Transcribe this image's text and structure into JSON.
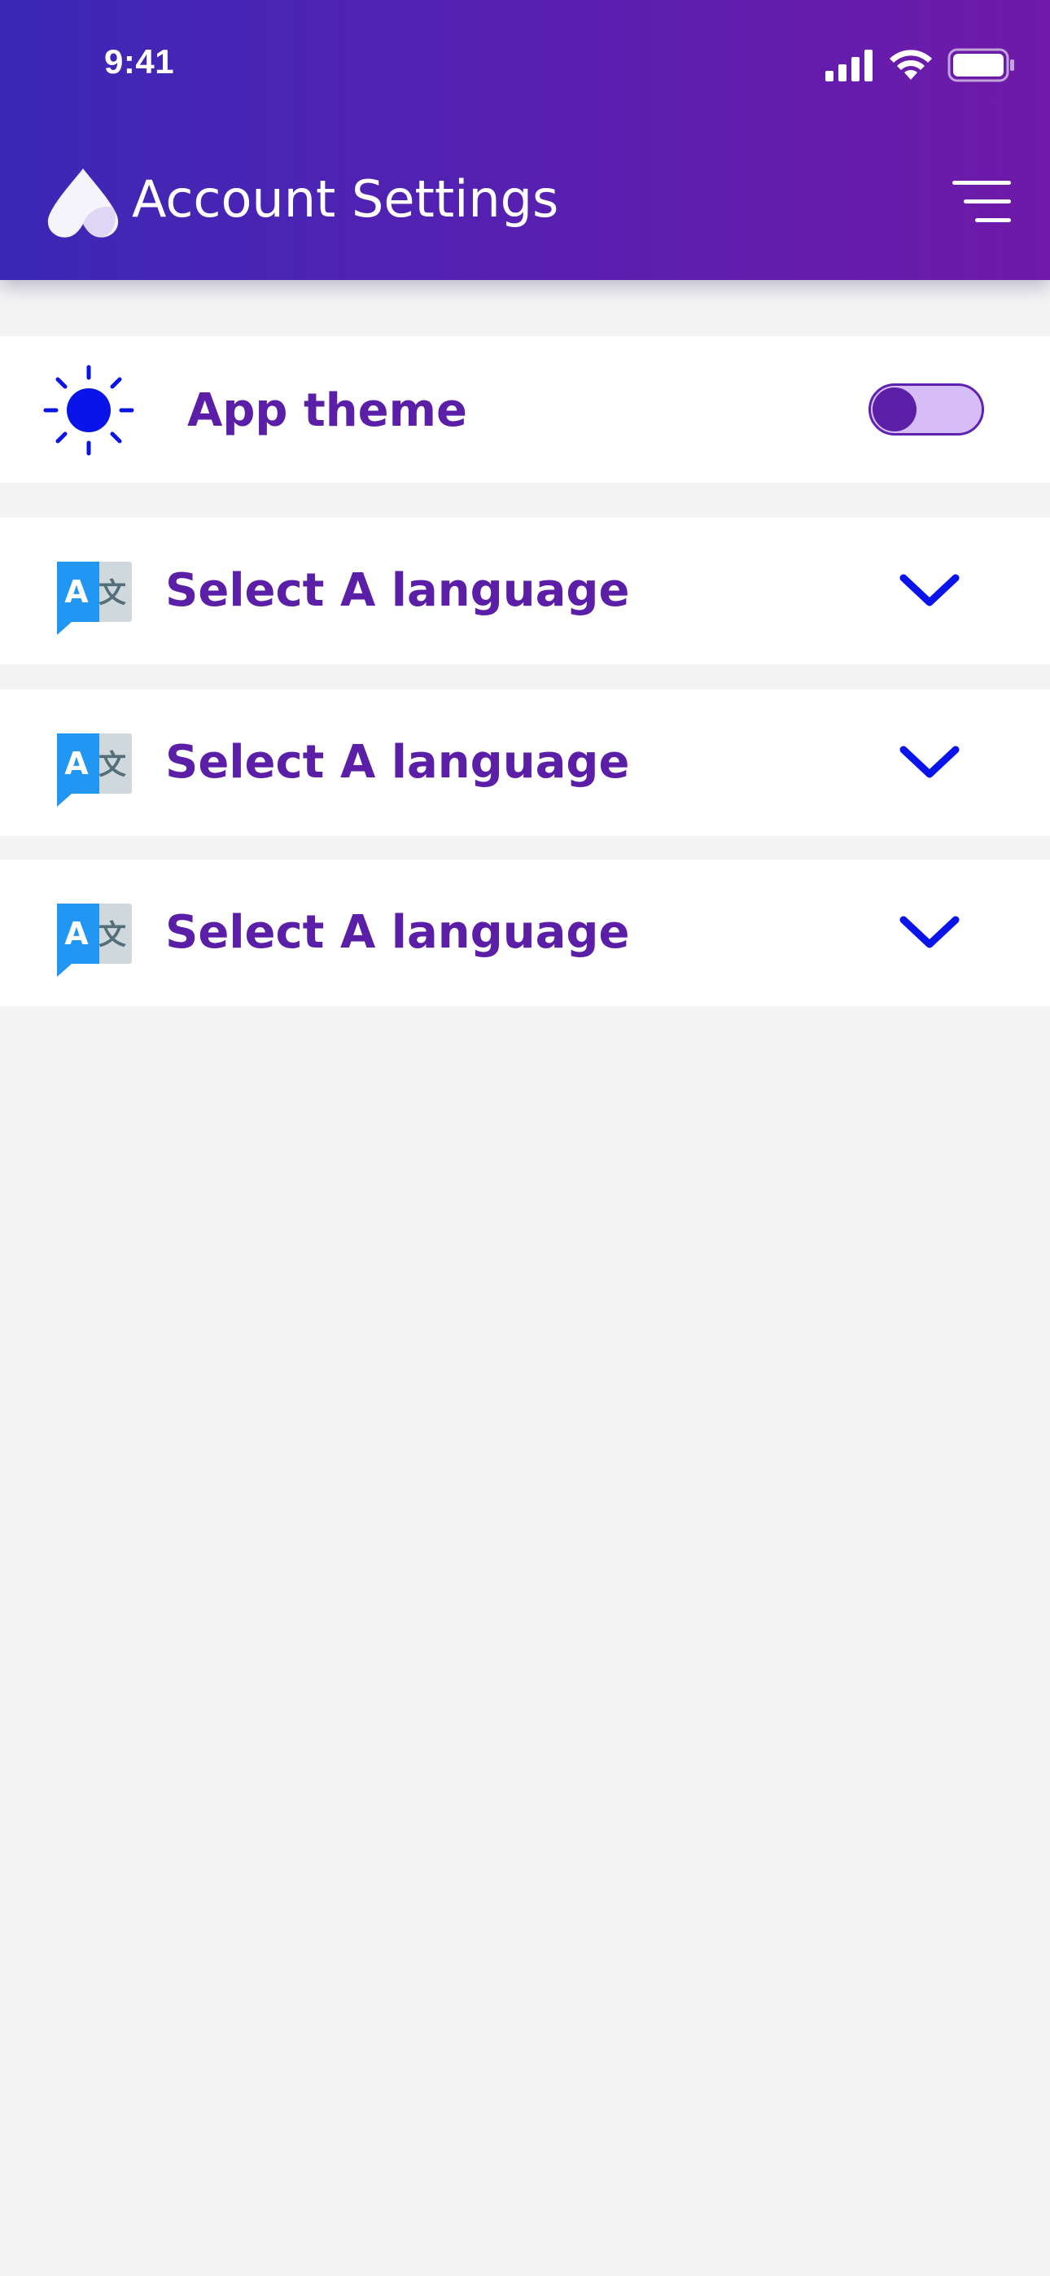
{
  "status_bar": {
    "time": "9:41"
  },
  "header": {
    "title": "Account Settings",
    "logo_icon": "app-logo-icon",
    "menu_icon": "hamburger-menu-icon"
  },
  "settings": {
    "theme": {
      "label": "App theme",
      "icon": "sun-icon",
      "toggle_on": false
    },
    "languages": [
      {
        "label": "Select A language",
        "icon": "translate-icon",
        "chevron": "chevron-down-icon"
      },
      {
        "label": "Select A language",
        "icon": "translate-icon",
        "chevron": "chevron-down-icon"
      },
      {
        "label": "Select A language",
        "icon": "translate-icon",
        "chevron": "chevron-down-icon"
      }
    ]
  },
  "colors": {
    "header_gradient_start": "#3b28b6",
    "header_gradient_end": "#6f1aa8",
    "label_purple": "#5a1fa6",
    "accent_blue": "#0a14e8",
    "background": "#f4f4f4"
  }
}
